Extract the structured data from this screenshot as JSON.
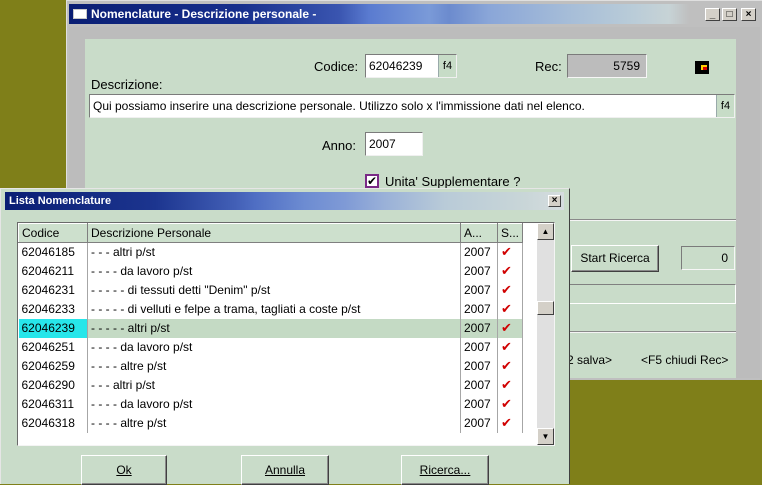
{
  "main_window": {
    "title": "Nomenclature - Descrizione personale -",
    "controls": {
      "minimize": "_",
      "maximize": "□",
      "close": "×"
    },
    "codice_label": "Codice:",
    "codice_value": "62046239",
    "f4_label": "f4",
    "rec_label": "Rec:",
    "rec_value": "5759",
    "descrizione_label": "Descrizione:",
    "descrizione_value": "Qui possiamo inserire una descrizione personale. Utilizzo solo x l'immissione dati nel elenco.",
    "anno_label": "Anno:",
    "anno_value": "2007",
    "unita_label": "Unita' Supplementare ?",
    "unita_checked": true,
    "start_ricerca": "Start Ricerca",
    "count_value": "0",
    "salva_hint": "2 salva>",
    "chiudi_hint": "<F5 chiudi Rec>"
  },
  "dialog": {
    "title": "Lista Nomenclature",
    "close": "×",
    "columns": [
      "Codice",
      "Descrizione Personale",
      "A...",
      "S..."
    ],
    "rows": [
      {
        "codice": "62046185",
        "descrizione": "- - - altri  p/st",
        "anno": "2007",
        "checked": true
      },
      {
        "codice": "62046211",
        "descrizione": "- - - - da lavoro  p/st",
        "anno": "2007",
        "checked": true
      },
      {
        "codice": "62046231",
        "descrizione": "- - - - - di tessuti detti \"Denim\"  p/st",
        "anno": "2007",
        "checked": true
      },
      {
        "codice": "62046233",
        "descrizione": "- - - - - di velluti e felpe a trama, tagliati a coste  p/st",
        "anno": "2007",
        "checked": true
      },
      {
        "codice": "62046239",
        "descrizione": "- - - - - altri  p/st",
        "anno": "2007",
        "checked": true,
        "selected": true
      },
      {
        "codice": "62046251",
        "descrizione": "- - - - da lavoro  p/st",
        "anno": "2007",
        "checked": true
      },
      {
        "codice": "62046259",
        "descrizione": "- - - - altre  p/st",
        "anno": "2007",
        "checked": true
      },
      {
        "codice": "62046290",
        "descrizione": "- - - altri  p/st",
        "anno": "2007",
        "checked": true
      },
      {
        "codice": "62046311",
        "descrizione": "- - - - da lavoro  p/st",
        "anno": "2007",
        "checked": true
      },
      {
        "codice": "62046318",
        "descrizione": "- - - - altre  p/st",
        "anno": "2007",
        "checked": true
      }
    ],
    "scroll_position": 0.35,
    "check_glyph": "✔",
    "buttons": {
      "ok": "Ok",
      "annulla": "Annulla",
      "ricerca": "Ricerca..."
    }
  },
  "colors": {
    "desktop": "#7f7f19",
    "panel": "#c9dcc9",
    "selection_code": "#27e6ea",
    "check": "#d00000"
  }
}
